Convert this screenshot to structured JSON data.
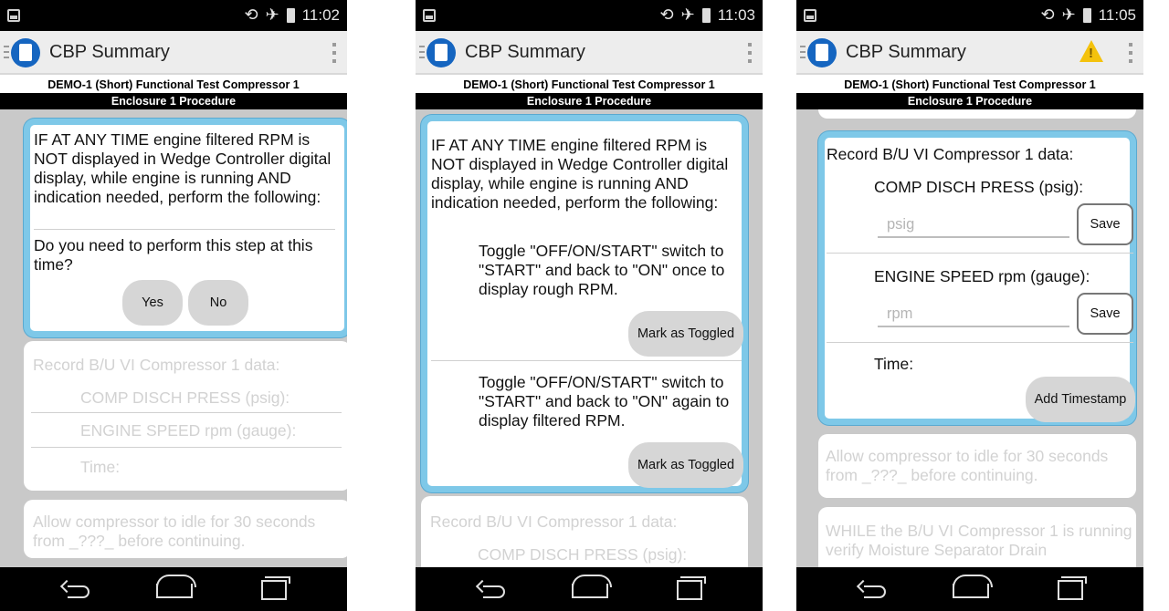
{
  "status_bar": {
    "s1_time": "11:02",
    "s2_time": "11:03",
    "s3_time": "11:05"
  },
  "app": {
    "title": "CBP Summary"
  },
  "header": {
    "procedure_title": "DEMO-1 (Short) Functional Test Compressor 1",
    "section": "Enclosure 1 Procedure"
  },
  "step_if": {
    "text": "IF AT ANY TIME engine filtered RPM is NOT displayed in Wedge Controller digital display, while engine is running AND indication needed, perform the following:",
    "question": "Do you need to perform this step at this time?",
    "yes_label": "Yes",
    "no_label": "No"
  },
  "toggles": [
    {
      "text": "Toggle \"OFF/ON/START\" switch to \"START\" and back to \"ON\" once to display rough RPM.",
      "button": "Mark as Toggled"
    },
    {
      "text": "Toggle \"OFF/ON/START\" switch to \"START\" and back to \"ON\" again to display filtered RPM.",
      "button": "Mark as Toggled"
    }
  ],
  "record": {
    "title": "Record B/U VI Compressor 1 data:",
    "field1_label": "COMP DISCH PRESS (psig):",
    "field1_placeholder": "psig",
    "field2_label": "ENGINE SPEED rpm (gauge):",
    "field2_placeholder": "rpm",
    "time_label": "Time:",
    "save_label": "Save",
    "timestamp_label": "Add Timestamp"
  },
  "allow_idle": {
    "text": "Allow compressor to idle for 30 seconds from _???_ before continuing."
  },
  "while_step": {
    "text": "WHILE the B/U VI Compressor 1 is running verify Moisture Separator Drain"
  },
  "colors": {
    "active_border": "#7ec8e8",
    "content_bg": "#c9c9c9",
    "warning": "#f4c20d",
    "logo": "#1565c0"
  }
}
